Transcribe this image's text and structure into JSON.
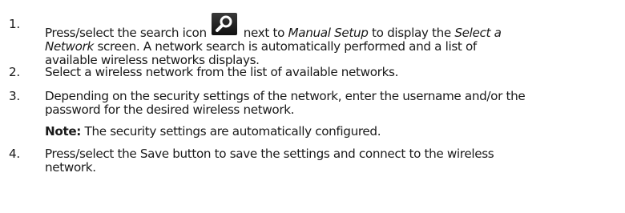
{
  "steps": [
    {
      "num": "1.",
      "line1_a": "Press/select the search icon",
      "line1_b": "next to",
      "line1_c": "Manual Setup",
      "line1_d": "to display the",
      "line1_e": "Select a",
      "line2_a": "Network",
      "line2_b": "screen. A network search is automatically performed and a list of",
      "line3": "available wireless networks displays."
    },
    {
      "num": "2.",
      "line1": "Select a wireless network from the list of available networks."
    },
    {
      "num": "3.",
      "line1": "Depending on the security settings of the network, enter the username and/or the",
      "line2": "password for the desired wireless network."
    },
    {
      "num": "4.",
      "line1": "Press/select the Save button to save the settings and connect to the wireless",
      "line2": "network."
    }
  ],
  "note": {
    "label": "Note:",
    "text": "The security settings are automatically configured."
  },
  "icons": {
    "search": "search-icon"
  }
}
